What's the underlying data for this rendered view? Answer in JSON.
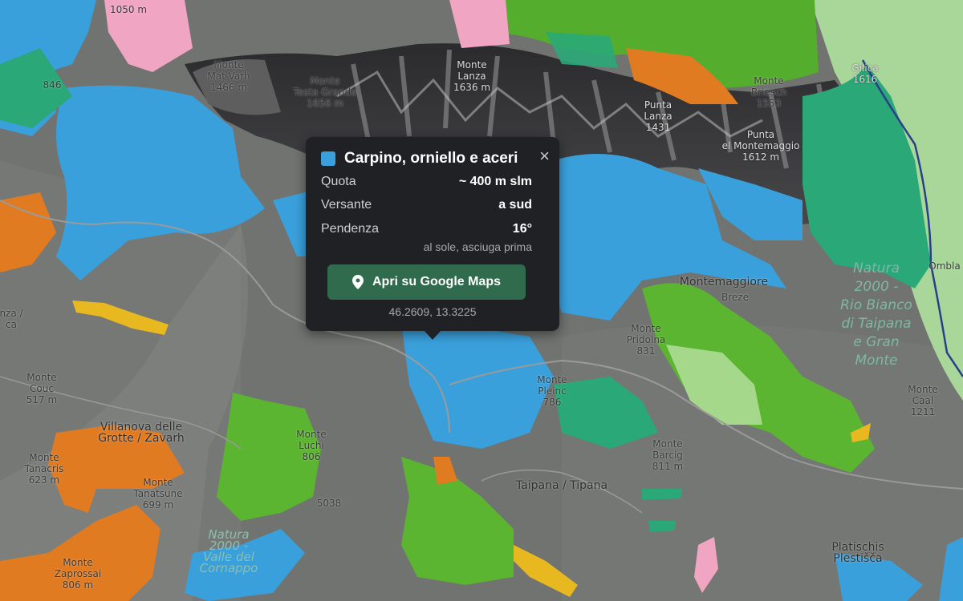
{
  "map": {
    "labels": [
      {
        "text": "1050 m",
        "cls": ""
      },
      {
        "text": "Monte\nMat Varh\n1466 m",
        "cls": ""
      },
      {
        "text": "Monte\nTesta Grande\n1656 m",
        "cls": ""
      },
      {
        "text": "Monte\nLanza\n1636 m",
        "cls": ""
      },
      {
        "text": "Monte\nBriesch\n1553",
        "cls": ""
      },
      {
        "text": "Punta\nLanza\n1431",
        "cls": ""
      },
      {
        "text": "Punta\nel Montemaggio\n1612 m",
        "cls": ""
      },
      {
        "text": "Gilica\n1616",
        "cls": "dark"
      },
      {
        "text": "846",
        "cls": ""
      },
      {
        "text": "Monte\nCouc\n517 m",
        "cls": ""
      },
      {
        "text": "Villanova delle\nGrotte / Zavarh",
        "cls": "big"
      },
      {
        "text": "Monte\nTanacris\n623 m",
        "cls": ""
      },
      {
        "text": "Monte\nTanatsune\n699 m",
        "cls": ""
      },
      {
        "text": "Monte\nZaprossai\n806 m",
        "cls": ""
      },
      {
        "text": "Monte\nLuchi\n806",
        "cls": ""
      },
      {
        "text": "5038",
        "cls": ""
      },
      {
        "text": "Montemaggiore",
        "cls": "big"
      },
      {
        "text": "Breze",
        "cls": ""
      },
      {
        "text": "Monte\nPridolna\n831",
        "cls": ""
      },
      {
        "text": "Monte\nPleinc\n786",
        "cls": ""
      },
      {
        "text": "Monte\nBarcig\n811 m",
        "cls": ""
      },
      {
        "text": "Taipana / Tipana",
        "cls": "big"
      },
      {
        "text": "Platischis\nPlestišča",
        "cls": "big"
      },
      {
        "text": "Natura\n2000 -\nRio Bianco\ndi Taipana\ne Gran\nMonte",
        "cls": "park"
      },
      {
        "text": "Natura\n2000 -\nValle del\nCornappo",
        "cls": "parkl"
      },
      {
        "text": "Ombla",
        "cls": ""
      },
      {
        "text": "Monte\nCaal\n1211",
        "cls": ""
      },
      {
        "text": "nza /\nca",
        "cls": ""
      }
    ]
  },
  "popup": {
    "title": "Carpino, orniello e aceri",
    "swatch_color": "#3aa0db",
    "close_icon": "×",
    "rows": [
      {
        "key": "Quota",
        "value": "~ 400 m slm"
      },
      {
        "key": "Versante",
        "value": "a sud"
      },
      {
        "key": "Pendenza",
        "value": "16°"
      }
    ],
    "note": "al sole, asciuga prima",
    "button_label": "Apri su Google Maps",
    "button_icon": "map-pin-icon",
    "coords": "46.2609, 13.3225"
  },
  "colors": {
    "popup_bg": "#202124",
    "button_bg": "#2f6b4c",
    "forest_blue": "#3aa0db",
    "forest_green": "#5cb531",
    "forest_orange": "#e07b22",
    "forest_teal": "#2aa877",
    "forest_yellow": "#e7b820",
    "forest_pink": "#f0a6c3"
  }
}
